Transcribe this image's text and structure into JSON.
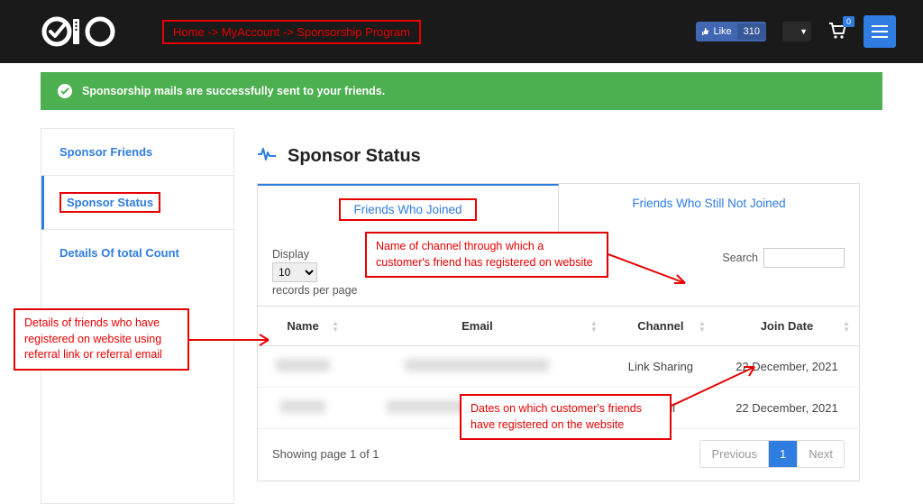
{
  "header": {
    "breadcrumb": "Home -> MyAccount -> Sponsorship Program",
    "fb_like_label": "Like",
    "fb_like_count": "310",
    "cart_count": "0"
  },
  "alert": {
    "message": "Sponsorship mails are successfully sent to your friends."
  },
  "sidebar": {
    "items": [
      {
        "label": "Sponsor Friends"
      },
      {
        "label": "Sponsor Status"
      },
      {
        "label": "Details Of total Count"
      }
    ]
  },
  "main": {
    "title": "Sponsor Status",
    "tabs": [
      {
        "label": "Friends Who Joined"
      },
      {
        "label": "Friends Who Still Not Joined"
      }
    ],
    "display_label": "Display",
    "display_value": "10",
    "records_label": "records per page",
    "search_label": "Search",
    "columns": {
      "name": "Name",
      "email": "Email",
      "channel": "Channel",
      "join_date": "Join Date"
    },
    "rows": [
      {
        "channel": "Link Sharing",
        "join_date": "22 December, 2021"
      },
      {
        "channel": "Email",
        "join_date": "22 December, 2021"
      }
    ],
    "showing": "Showing page 1 of 1",
    "pager": {
      "prev": "Previous",
      "page": "1",
      "next": "Next"
    }
  },
  "annotations": {
    "left": "Details of friends who have registered on website using referral link or referral email",
    "top": "Name of channel through which a customer's friend has registered on website",
    "bottom": "Dates on which customer's friends have registered on the website"
  }
}
